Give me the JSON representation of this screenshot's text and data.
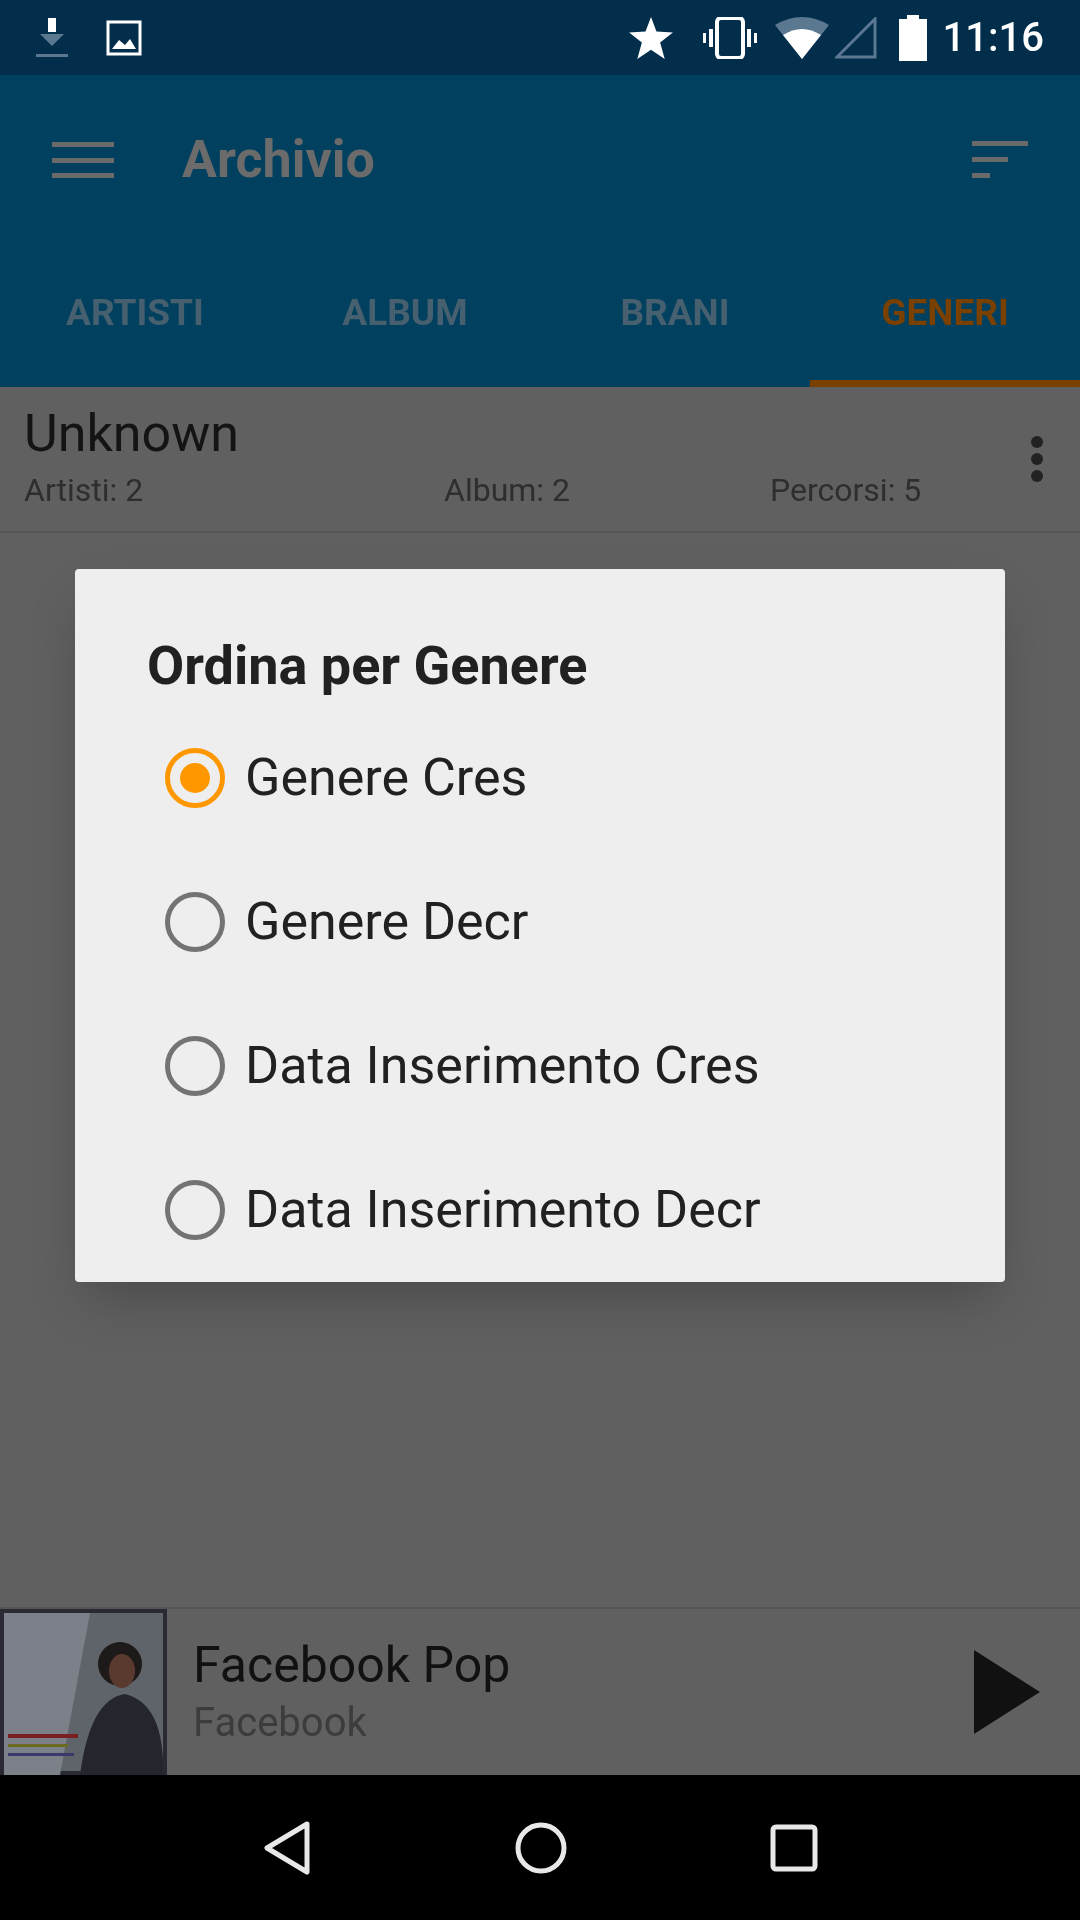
{
  "status_bar": {
    "time": "11:16"
  },
  "app_bar": {
    "title": "Archivio"
  },
  "tabs": [
    {
      "label": "ARTISTI",
      "selected": false
    },
    {
      "label": "ALBUM",
      "selected": false
    },
    {
      "label": "BRANI",
      "selected": false
    },
    {
      "label": "GENERI",
      "selected": true
    }
  ],
  "genres": [
    {
      "name": "Unknown",
      "artists": "Artisti: 2",
      "albums": "Album: 2",
      "tracks": "Percorsi: 5"
    }
  ],
  "dialog": {
    "title": "Ordina per Genere",
    "options": [
      {
        "label": "Genere Cres",
        "selected": true
      },
      {
        "label": "Genere Decr",
        "selected": false
      },
      {
        "label": "Data Inserimento Cres",
        "selected": false
      },
      {
        "label": "Data Inserimento Decr",
        "selected": false
      }
    ]
  },
  "now_playing": {
    "title": "Facebook Pop",
    "artist": "Facebook"
  }
}
